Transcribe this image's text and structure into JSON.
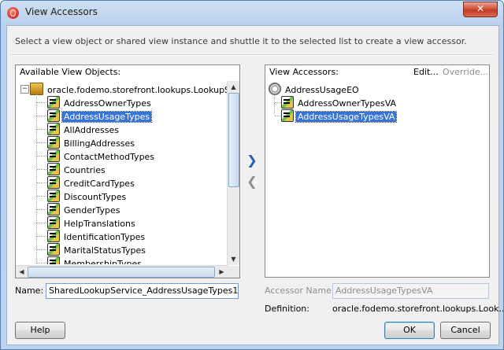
{
  "window": {
    "title": "View Accessors",
    "close_glyph": "✕"
  },
  "instruction": "Select a view object or shared view instance and shuttle it to the selected list to create a view accessor.",
  "available": {
    "header": "Available View Objects:",
    "root": "oracle.fodemo.storefront.lookups.LookupServic",
    "items": [
      "AddressOwnerTypes",
      "AddressUsageTypes",
      "AllAddresses",
      "BillingAddresses",
      "ContactMethodTypes",
      "Countries",
      "CreditCardTypes",
      "DiscountTypes",
      "GenderTypes",
      "HelpTranslations",
      "IdentificationTypes",
      "MaritalStatusTypes",
      "MembershipTypes"
    ],
    "selected_index": 1
  },
  "shuttle": {
    "add_glyph": "❯",
    "remove_glyph": "❮"
  },
  "accessors": {
    "header": "View Accessors:",
    "edit_label": "Edit...",
    "override_label": "Override...",
    "root": "AddressUsageEO",
    "items": [
      "AddressOwnerTypesVA",
      "AddressUsageTypesVA"
    ],
    "selected_index": 1
  },
  "name_field": {
    "label": "Name:",
    "value": "SharedLookupService_AddressUsageTypes1"
  },
  "accessor_name": {
    "label": "Accessor Name:",
    "value": "AddressUsageTypesVA"
  },
  "definition": {
    "label": "Definition:",
    "value": "oracle.fodemo.storefront.lookups.Look..."
  },
  "buttons": {
    "help": "Help",
    "ok": "OK",
    "cancel": "Cancel"
  }
}
